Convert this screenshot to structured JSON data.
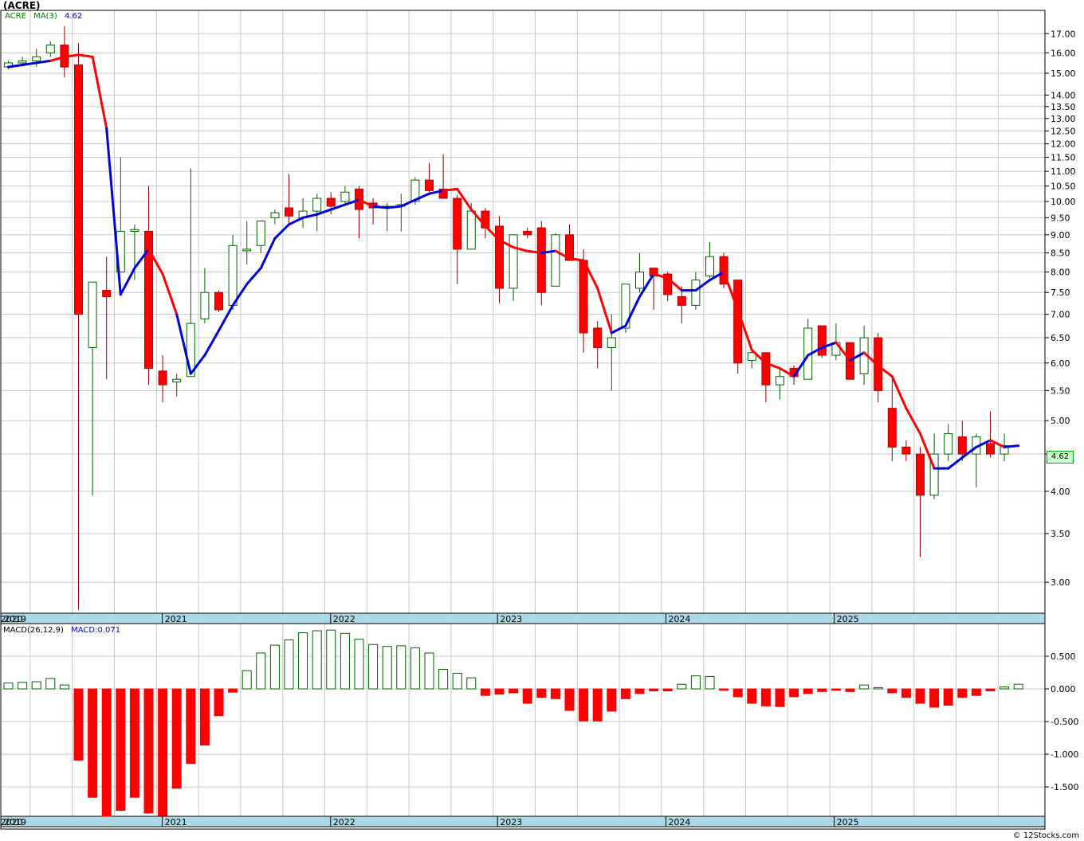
{
  "header": {
    "ticker": "(ACRE)",
    "symbol": "ACRE",
    "ma_label": "MA(3)",
    "ma_value": "4.62",
    "last_price": "4.62"
  },
  "macd_panel": {
    "label": "MACD(26,12,9)",
    "value_text": "MACD:0.071"
  },
  "credit": "© 12Stocks.com",
  "colors": {
    "up_candle_fill": "#ffffff",
    "up_candle_stroke": "#006400",
    "down_candle": "#ff0000",
    "ma_up": "#0000dd",
    "ma_down": "#ff0000",
    "macd_pos_stroke": "#006400",
    "macd_neg_fill": "#ff0000",
    "timeline_band": "#add8e6",
    "grid": "#c8c8c8"
  },
  "chart_data": [
    {
      "type": "candlestick",
      "title": "(ACRE)",
      "scale": "log",
      "ylim": [
        2.75,
        18.0
      ],
      "yticks": [
        "3.00",
        "3.50",
        "4.00",
        "4.50",
        "5.00",
        "5.50",
        "6.00",
        "6.50",
        "7.00",
        "7.50",
        "8.00",
        "8.50",
        "9.00",
        "9.50",
        "10.00",
        "10.50",
        "11.00",
        "11.50",
        "12.00",
        "12.50",
        "13.00",
        "13.50",
        "14.00",
        "15.00",
        "16.00",
        "17.00"
      ],
      "x_labels": [
        "2019",
        "2020",
        "2021",
        "2022",
        "2023",
        "2024",
        "2025"
      ],
      "x_label_month_index": [
        -1,
        1,
        13,
        25,
        37,
        49,
        61
      ],
      "grid": true,
      "candles": [
        {
          "o": 15.3,
          "h": 15.6,
          "l": 15.2,
          "c": 15.5
        },
        {
          "o": 15.5,
          "h": 15.8,
          "l": 15.4,
          "c": 15.6
        },
        {
          "o": 15.6,
          "h": 16.2,
          "l": 15.3,
          "c": 15.8
        },
        {
          "o": 16.0,
          "h": 16.6,
          "l": 15.8,
          "c": 16.4
        },
        {
          "o": 16.4,
          "h": 17.4,
          "l": 14.8,
          "c": 15.3
        },
        {
          "o": 15.4,
          "h": 16.5,
          "l": 2.75,
          "c": 7.0
        },
        {
          "o": 6.3,
          "h": 7.75,
          "l": 3.95,
          "c": 7.75
        },
        {
          "o": 7.55,
          "h": 8.4,
          "l": 5.7,
          "c": 7.4
        },
        {
          "o": 8.0,
          "h": 11.5,
          "l": 8.0,
          "c": 9.1
        },
        {
          "o": 9.1,
          "h": 9.3,
          "l": 7.8,
          "c": 9.15
        },
        {
          "o": 9.1,
          "h": 10.5,
          "l": 5.6,
          "c": 5.9
        },
        {
          "o": 5.85,
          "h": 6.15,
          "l": 5.3,
          "c": 5.6
        },
        {
          "o": 5.65,
          "h": 5.8,
          "l": 5.4,
          "c": 5.7
        },
        {
          "o": 5.75,
          "h": 11.1,
          "l": 5.75,
          "c": 6.8
        },
        {
          "o": 6.9,
          "h": 8.1,
          "l": 6.8,
          "c": 7.5
        },
        {
          "o": 7.5,
          "h": 7.55,
          "l": 7.05,
          "c": 7.1
        },
        {
          "o": 7.2,
          "h": 9.0,
          "l": 7.1,
          "c": 8.7
        },
        {
          "o": 8.6,
          "h": 9.4,
          "l": 8.2,
          "c": 8.6
        },
        {
          "o": 8.7,
          "h": 9.4,
          "l": 8.5,
          "c": 9.4
        },
        {
          "o": 9.5,
          "h": 9.75,
          "l": 9.3,
          "c": 9.65
        },
        {
          "o": 9.8,
          "h": 10.9,
          "l": 9.3,
          "c": 9.55
        },
        {
          "o": 9.5,
          "h": 10.1,
          "l": 9.2,
          "c": 9.7
        },
        {
          "o": 9.7,
          "h": 10.25,
          "l": 9.1,
          "c": 10.1
        },
        {
          "o": 10.1,
          "h": 10.3,
          "l": 9.6,
          "c": 9.85
        },
        {
          "o": 10.0,
          "h": 10.5,
          "l": 9.95,
          "c": 10.3
        },
        {
          "o": 10.4,
          "h": 10.5,
          "l": 8.9,
          "c": 9.75
        },
        {
          "o": 9.95,
          "h": 10.1,
          "l": 9.3,
          "c": 9.8
        },
        {
          "o": 9.85,
          "h": 9.95,
          "l": 9.1,
          "c": 9.85
        },
        {
          "o": 9.85,
          "h": 10.25,
          "l": 9.1,
          "c": 9.9
        },
        {
          "o": 10.0,
          "h": 10.8,
          "l": 9.9,
          "c": 10.7
        },
        {
          "o": 10.7,
          "h": 11.3,
          "l": 10.3,
          "c": 10.35
        },
        {
          "o": 10.4,
          "h": 11.6,
          "l": 10.1,
          "c": 10.1
        },
        {
          "o": 10.1,
          "h": 10.2,
          "l": 7.7,
          "c": 8.6
        },
        {
          "o": 8.6,
          "h": 9.95,
          "l": 8.6,
          "c": 9.7
        },
        {
          "o": 9.7,
          "h": 9.8,
          "l": 8.9,
          "c": 9.2
        },
        {
          "o": 9.25,
          "h": 9.55,
          "l": 7.25,
          "c": 7.6
        },
        {
          "o": 7.6,
          "h": 9.0,
          "l": 7.3,
          "c": 9.0
        },
        {
          "o": 9.1,
          "h": 9.2,
          "l": 8.9,
          "c": 9.0
        },
        {
          "o": 9.2,
          "h": 9.4,
          "l": 7.2,
          "c": 7.5
        },
        {
          "o": 7.65,
          "h": 9.05,
          "l": 7.65,
          "c": 9.0
        },
        {
          "o": 9.0,
          "h": 9.3,
          "l": 8.3,
          "c": 8.3
        },
        {
          "o": 8.3,
          "h": 8.6,
          "l": 6.2,
          "c": 6.6
        },
        {
          "o": 6.7,
          "h": 6.85,
          "l": 5.9,
          "c": 6.3
        },
        {
          "o": 6.3,
          "h": 7.0,
          "l": 5.5,
          "c": 6.5
        },
        {
          "o": 6.7,
          "h": 7.7,
          "l": 6.6,
          "c": 7.7
        },
        {
          "o": 7.6,
          "h": 8.5,
          "l": 7.5,
          "c": 8.0
        },
        {
          "o": 8.1,
          "h": 8.1,
          "l": 7.1,
          "c": 7.9
        },
        {
          "o": 7.95,
          "h": 8.0,
          "l": 7.3,
          "c": 7.45
        },
        {
          "o": 7.4,
          "h": 7.65,
          "l": 6.8,
          "c": 7.2
        },
        {
          "o": 7.2,
          "h": 8.0,
          "l": 7.1,
          "c": 7.8
        },
        {
          "o": 7.9,
          "h": 8.8,
          "l": 7.85,
          "c": 8.4
        },
        {
          "o": 8.4,
          "h": 8.5,
          "l": 7.6,
          "c": 7.7
        },
        {
          "o": 7.8,
          "h": 7.8,
          "l": 5.8,
          "c": 6.0
        },
        {
          "o": 6.05,
          "h": 6.3,
          "l": 5.9,
          "c": 6.2
        },
        {
          "o": 6.2,
          "h": 6.2,
          "l": 5.3,
          "c": 5.6
        },
        {
          "o": 5.6,
          "h": 5.9,
          "l": 5.35,
          "c": 5.75
        },
        {
          "o": 5.9,
          "h": 5.95,
          "l": 5.6,
          "c": 5.75
        },
        {
          "o": 5.7,
          "h": 6.9,
          "l": 5.7,
          "c": 6.7
        },
        {
          "o": 6.75,
          "h": 6.75,
          "l": 6.1,
          "c": 6.15
        },
        {
          "o": 6.15,
          "h": 6.8,
          "l": 6.05,
          "c": 6.4
        },
        {
          "o": 6.4,
          "h": 6.4,
          "l": 5.7,
          "c": 5.7
        },
        {
          "o": 5.8,
          "h": 6.75,
          "l": 5.6,
          "c": 6.5
        },
        {
          "o": 6.5,
          "h": 6.6,
          "l": 5.3,
          "c": 5.5
        },
        {
          "o": 5.2,
          "h": 5.7,
          "l": 4.4,
          "c": 4.6
        },
        {
          "o": 4.6,
          "h": 4.7,
          "l": 4.4,
          "c": 4.5
        },
        {
          "o": 4.5,
          "h": 4.6,
          "l": 3.25,
          "c": 3.95
        },
        {
          "o": 3.95,
          "h": 4.8,
          "l": 3.9,
          "c": 4.5
        },
        {
          "o": 4.5,
          "h": 4.95,
          "l": 4.4,
          "c": 4.8
        },
        {
          "o": 4.75,
          "h": 5.0,
          "l": 4.4,
          "c": 4.5
        },
        {
          "o": 4.5,
          "h": 4.8,
          "l": 4.05,
          "c": 4.75
        },
        {
          "o": 4.65,
          "h": 5.15,
          "l": 4.45,
          "c": 4.5
        },
        {
          "o": 4.5,
          "h": 4.8,
          "l": 4.4,
          "c": 4.62
        }
      ],
      "ma3": [
        15.3,
        15.4,
        15.5,
        15.6,
        15.8,
        15.9,
        15.8,
        12.6,
        7.45,
        8.1,
        8.6,
        7.95,
        7.0,
        5.8,
        6.15,
        6.65,
        7.2,
        7.7,
        8.1,
        8.9,
        9.3,
        9.5,
        9.6,
        9.75,
        9.9,
        10.05,
        9.85,
        9.8,
        9.85,
        10.05,
        10.25,
        10.35,
        10.4,
        9.75,
        9.25,
        8.85,
        8.65,
        8.55,
        8.5,
        8.55,
        8.35,
        8.3,
        7.6,
        6.6,
        6.75,
        7.4,
        7.95,
        7.85,
        7.55,
        7.55,
        7.8,
        8.0,
        7.1,
        6.25,
        6.0,
        5.9,
        5.75,
        6.15,
        6.3,
        6.4,
        6.05,
        6.2,
        5.95,
        5.75,
        5.2,
        4.8,
        4.3,
        4.3,
        4.45,
        4.6,
        4.7,
        4.6,
        4.62
      ],
      "ma3_up": [
        true,
        true,
        true,
        true,
        false,
        false,
        false,
        false,
        true,
        true,
        true,
        false,
        false,
        true,
        true,
        true,
        true,
        true,
        true,
        true,
        true,
        true,
        true,
        true,
        true,
        true,
        false,
        true,
        true,
        true,
        true,
        true,
        false,
        false,
        false,
        false,
        false,
        false,
        false,
        true,
        false,
        false,
        false,
        false,
        true,
        true,
        true,
        false,
        false,
        true,
        true,
        true,
        false,
        false,
        false,
        false,
        false,
        true,
        true,
        true,
        false,
        true,
        false,
        false,
        false,
        false,
        false,
        true,
        true,
        true,
        true,
        false,
        true
      ]
    },
    {
      "type": "bar",
      "title": "MACD(26,12,9)",
      "ylim": [
        -1.95,
        1.0
      ],
      "yticks": [
        "0.500",
        "0.000",
        "-0.500",
        "-1.000",
        "-1.500"
      ],
      "x_labels": [
        "2019",
        "2020",
        "2021",
        "2022",
        "2023",
        "2024",
        "2025"
      ],
      "grid": true,
      "values": [
        0.09,
        0.1,
        0.11,
        0.16,
        0.06,
        -1.09,
        -1.66,
        -1.95,
        -1.86,
        -1.66,
        -1.9,
        -1.94,
        -1.52,
        -1.14,
        -0.86,
        -0.41,
        -0.05,
        0.28,
        0.55,
        0.67,
        0.75,
        0.86,
        0.89,
        0.9,
        0.85,
        0.76,
        0.68,
        0.65,
        0.66,
        0.63,
        0.55,
        0.3,
        0.24,
        0.17,
        -0.1,
        -0.08,
        -0.06,
        -0.22,
        -0.13,
        -0.15,
        -0.33,
        -0.49,
        -0.49,
        -0.34,
        -0.15,
        -0.07,
        -0.03,
        -0.03,
        0.07,
        0.2,
        0.19,
        -0.02,
        -0.12,
        -0.22,
        -0.26,
        -0.27,
        -0.12,
        -0.07,
        -0.04,
        -0.02,
        -0.04,
        0.06,
        0.02,
        -0.06,
        -0.13,
        -0.22,
        -0.28,
        -0.25,
        -0.13,
        -0.1,
        -0.03,
        0.03,
        0.071
      ]
    }
  ]
}
